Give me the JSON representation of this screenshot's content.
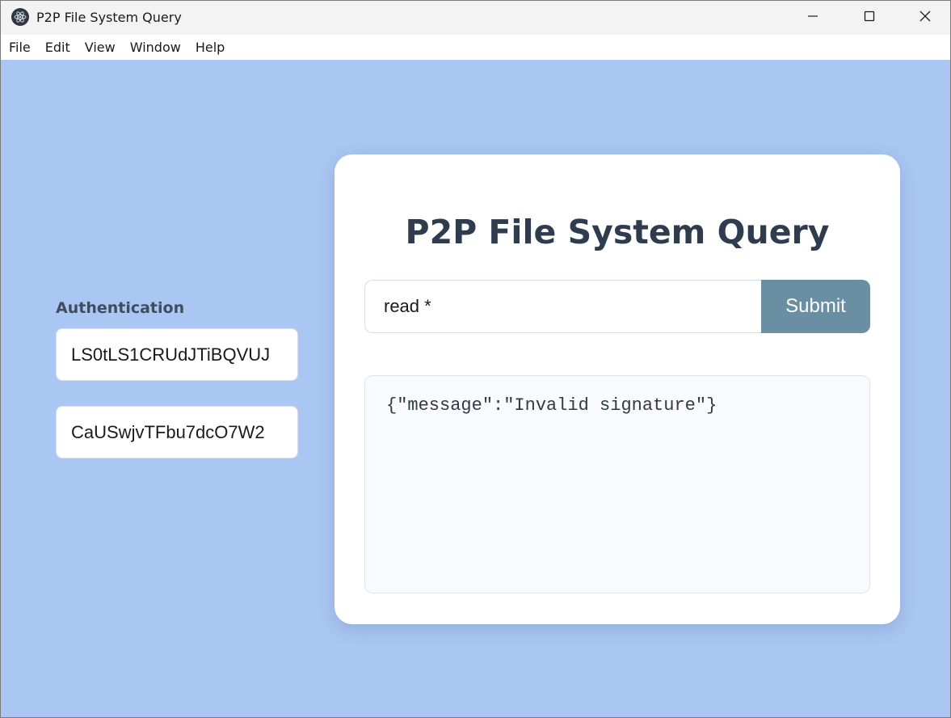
{
  "window": {
    "title": "P2P File System Query",
    "app_icon": "electron-atom-icon",
    "controls": [
      "minimize-icon",
      "maximize-icon",
      "close-icon"
    ]
  },
  "menubar": {
    "items": [
      "File",
      "Edit",
      "View",
      "Window",
      "Help"
    ]
  },
  "theme": {
    "background": "#aac6f3",
    "card": "#ffffff",
    "submit_button": "#6a8fa3",
    "title_text": "#2e3c4e"
  },
  "auth": {
    "label": "Authentication",
    "key_1_value": "LS0tLS1CRUdJTiBQVUJ",
    "key_2_value": "CaUSwjvTFbu7dcO7W2"
  },
  "main": {
    "title": "P2P File System Query",
    "query_value": "read *",
    "submit_label": "Submit",
    "result_text": "{\"message\":\"Invalid signature\"}"
  }
}
